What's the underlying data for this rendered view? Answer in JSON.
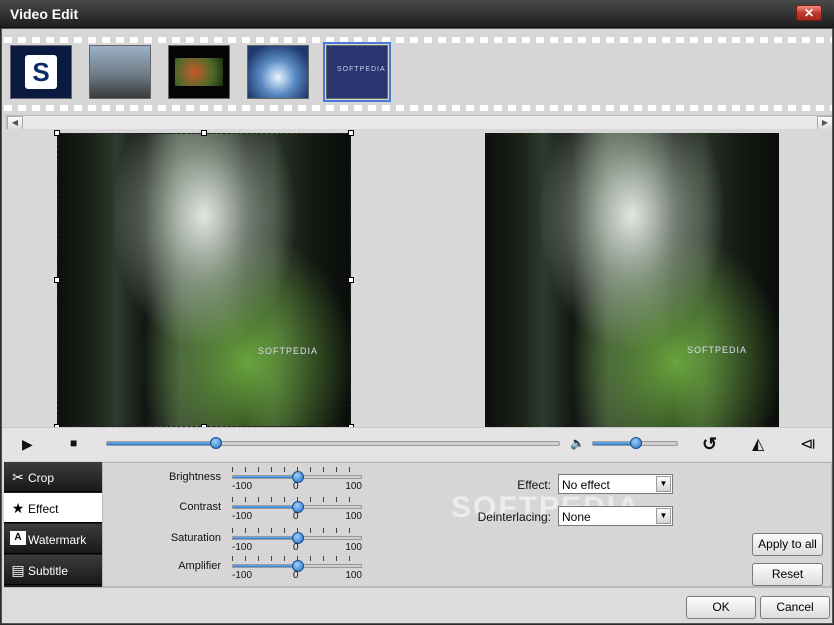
{
  "window": {
    "title": "Video Edit",
    "close_label": "✕"
  },
  "filmstrip": {
    "thumbnails": [
      {
        "name": "thumb-softpedia-logo",
        "logo_text": "S"
      },
      {
        "name": "thumb-street"
      },
      {
        "name": "thumb-flowers"
      },
      {
        "name": "thumb-light"
      },
      {
        "name": "thumb-softpedia",
        "watermark": "SOFTPEDIA"
      }
    ],
    "scroll_left": "◀",
    "scroll_right": "▶"
  },
  "preview": {
    "left_watermark": "SOFTPEDIA",
    "right_watermark": "SOFTPEDIA"
  },
  "controls": {
    "play_icon": "▶",
    "stop_icon": "■",
    "volume_icon": "🔈",
    "rotate_icon": "↺",
    "flip_h_icon": "◭",
    "flip_v_icon": "⧏",
    "seek_progress": 0.24,
    "volume_level": 0.5
  },
  "sidebar": {
    "tabs": [
      {
        "label": "Crop",
        "icon": "✂"
      },
      {
        "label": "Effect",
        "icon": "★"
      },
      {
        "label": "Watermark",
        "icon": "A"
      },
      {
        "label": "Subtitle",
        "icon": "▤"
      }
    ]
  },
  "effect_panel": {
    "sliders": [
      {
        "label": "Brightness",
        "min": "-100",
        "mid": "0",
        "max": "100",
        "value": 0
      },
      {
        "label": "Contrast",
        "min": "-100",
        "mid": "0",
        "max": "100",
        "value": 0
      },
      {
        "label": "Saturation",
        "min": "-100",
        "mid": "0",
        "max": "100",
        "value": 0
      },
      {
        "label": "Amplifier",
        "min": "-100",
        "mid": "0",
        "max": "100",
        "value": 0
      }
    ],
    "effect_label": "Effect:",
    "effect_value": "No effect",
    "deinterlacing_label": "Deinterlacing:",
    "deinterlacing_value": "None",
    "apply_all_label": "Apply to all",
    "reset_label": "Reset",
    "watermark": "SOFTPEDIA"
  },
  "footer": {
    "ok_label": "OK",
    "cancel_label": "Cancel"
  }
}
